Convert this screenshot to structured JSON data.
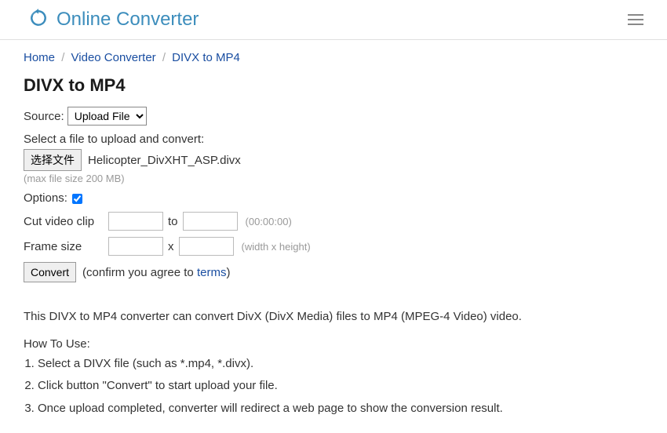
{
  "header": {
    "title": "Online Converter"
  },
  "breadcrumbs": {
    "items": [
      "Home",
      "Video Converter",
      "DIVX to MP4"
    ]
  },
  "page_title": "DIVX to MP4",
  "form": {
    "source_label": "Source:",
    "source_selected": "Upload File",
    "select_file_label": "Select a file to upload and convert:",
    "choose_file_btn": "选择文件",
    "chosen_file_name": "Helicopter_DivXHT_ASP.divx",
    "max_size_hint": "(max file size 200 MB)",
    "options_label": "Options:",
    "cut_label": "Cut video clip",
    "cut_to": "to",
    "cut_hint": "(00:00:00)",
    "frame_label": "Frame size",
    "frame_x": "x",
    "frame_hint": "(width x height)",
    "convert_btn": "Convert",
    "agree_prefix": "(confirm you agree to ",
    "terms_link": "terms",
    "agree_suffix": ")"
  },
  "description": "This DIVX to MP4 converter can convert DivX (DivX Media) files to MP4 (MPEG-4 Video) video.",
  "howto": {
    "title": "How To Use:",
    "steps": [
      "Select a DIVX file (such as *.mp4, *.divx).",
      "Click button \"Convert\" to start upload your file.",
      "Once upload completed, converter will redirect a web page to show the conversion result."
    ]
  }
}
